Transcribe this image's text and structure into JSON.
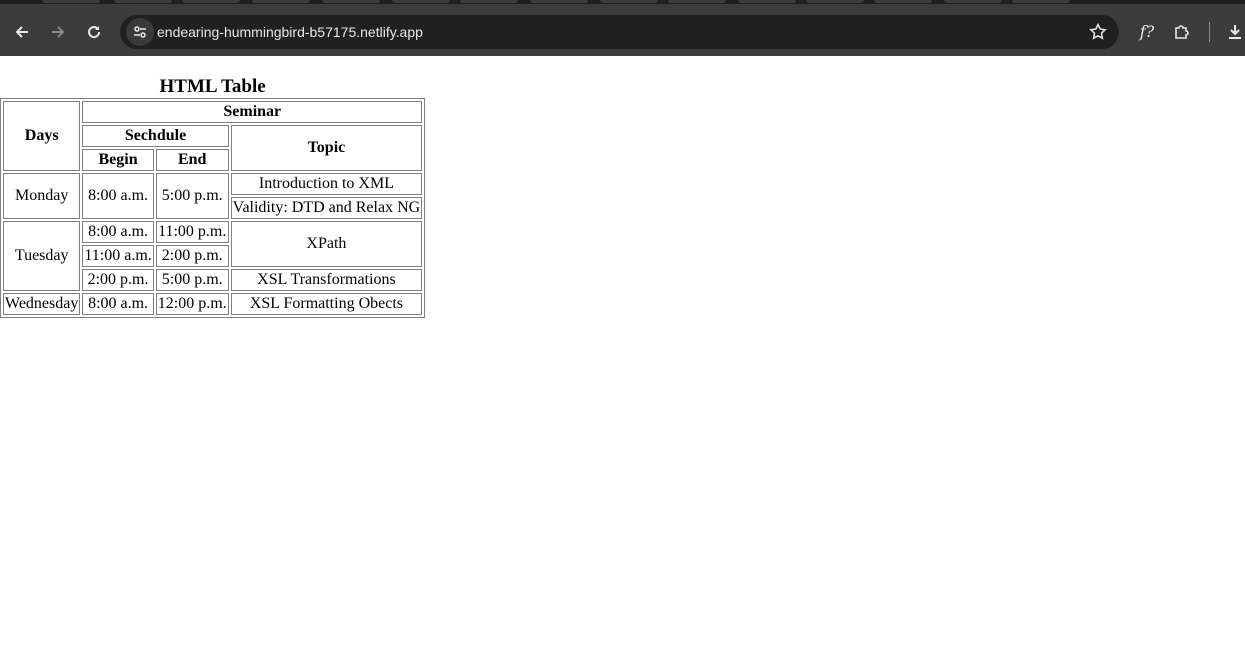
{
  "browser": {
    "url": "endearing-hummingbird-b57175.netlify.app",
    "icons": {
      "back": "arrow-left-icon",
      "forward": "arrow-right-icon",
      "reload": "reload-icon",
      "site_info": "site-settings-icon",
      "bookmark": "star-icon",
      "extension_fx": "f?",
      "extensions": "puzzle-icon",
      "download": "download-icon"
    }
  },
  "page": {
    "caption": "HTML Table",
    "headers": {
      "days": "Days",
      "seminar": "Seminar",
      "schedule": "Sechdule",
      "topic": "Topic",
      "begin": "Begin",
      "end": "End"
    },
    "rows": {
      "monday": {
        "day": "Monday",
        "begin": "8:00 a.m.",
        "end": "5:00 p.m.",
        "topic1": "Introduction to XML",
        "topic2": "Validity: DTD and Relax NG"
      },
      "tuesday": {
        "day": "Tuesday",
        "s1_begin": "8:00 a.m.",
        "s1_end": "11:00 p.m.",
        "s2_begin": "11:00 a.m.",
        "s2_end": "2:00 p.m.",
        "xpath": "XPath",
        "s3_begin": "2:00 p.m.",
        "s3_end": "5:00 p.m.",
        "s3_topic": "XSL Transformations"
      },
      "wednesday": {
        "day": "Wednesday",
        "begin": "8:00 a.m.",
        "end": "12:00 p.m.",
        "topic": "XSL Formatting Obects"
      }
    }
  }
}
